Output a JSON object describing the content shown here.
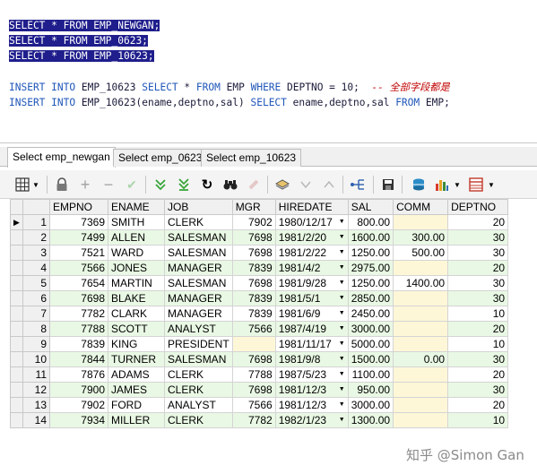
{
  "editor": {
    "selected_lines": [
      "SELECT * FROM EMP_NEWGAN;",
      "SELECT * FROM EMP_0623;",
      "SELECT * FROM EMP_10623;"
    ],
    "insert1": {
      "kw_insert": "INSERT",
      "kw_into": "INTO",
      "table": "EMP_10623",
      "kw_select": "SELECT",
      "star": "*",
      "kw_from": "FROM",
      "src": "EMP",
      "kw_where": "WHERE",
      "cond": "DEPTNO = 10;",
      "comment": "-- 全部字段都是"
    },
    "insert2": {
      "kw_insert": "INSERT",
      "kw_into": "INTO",
      "target": "EMP_10623(ename,deptno,sal)",
      "kw_select": "SELECT",
      "cols": "ename,deptno,sal",
      "kw_from": "FROM",
      "src": "EMP;"
    }
  },
  "tabs": [
    "Select emp_newgan",
    "Select emp_0623",
    "Select emp_10623"
  ],
  "grid": {
    "columns": [
      "EMPNO",
      "ENAME",
      "JOB",
      "MGR",
      "HIREDATE",
      "SAL",
      "COMM",
      "DEPTNO"
    ],
    "rows": [
      [
        "1",
        "7369",
        "SMITH",
        "CLERK",
        "7902",
        "1980/12/17",
        "800.00",
        "",
        "20"
      ],
      [
        "2",
        "7499",
        "ALLEN",
        "SALESMAN",
        "7698",
        "1981/2/20",
        "1600.00",
        "300.00",
        "30"
      ],
      [
        "3",
        "7521",
        "WARD",
        "SALESMAN",
        "7698",
        "1981/2/22",
        "1250.00",
        "500.00",
        "30"
      ],
      [
        "4",
        "7566",
        "JONES",
        "MANAGER",
        "7839",
        "1981/4/2",
        "2975.00",
        "",
        "20"
      ],
      [
        "5",
        "7654",
        "MARTIN",
        "SALESMAN",
        "7698",
        "1981/9/28",
        "1250.00",
        "1400.00",
        "30"
      ],
      [
        "6",
        "7698",
        "BLAKE",
        "MANAGER",
        "7839",
        "1981/5/1",
        "2850.00",
        "",
        "30"
      ],
      [
        "7",
        "7782",
        "CLARK",
        "MANAGER",
        "7839",
        "1981/6/9",
        "2450.00",
        "",
        "10"
      ],
      [
        "8",
        "7788",
        "SCOTT",
        "ANALYST",
        "7566",
        "1987/4/19",
        "3000.00",
        "",
        "20"
      ],
      [
        "9",
        "7839",
        "KING",
        "PRESIDENT",
        "",
        "1981/11/17",
        "5000.00",
        "",
        "10"
      ],
      [
        "10",
        "7844",
        "TURNER",
        "SALESMAN",
        "7698",
        "1981/9/8",
        "1500.00",
        "0.00",
        "30"
      ],
      [
        "11",
        "7876",
        "ADAMS",
        "CLERK",
        "7788",
        "1987/5/23",
        "1100.00",
        "",
        "20"
      ],
      [
        "12",
        "7900",
        "JAMES",
        "CLERK",
        "7698",
        "1981/12/3",
        "950.00",
        "",
        "30"
      ],
      [
        "13",
        "7902",
        "FORD",
        "ANALYST",
        "7566",
        "1981/12/3",
        "3000.00",
        "",
        "20"
      ],
      [
        "14",
        "7934",
        "MILLER",
        "CLERK",
        "7782",
        "1982/1/23",
        "1300.00",
        "",
        "10"
      ]
    ]
  },
  "toolbar_icons": [
    "grid-view-icon",
    "lock-icon",
    "add-record-icon",
    "delete-record-icon",
    "post-changes-icon",
    "fetch-next-icon",
    "fetch-last-icon",
    "refresh-icon",
    "find-icon",
    "clear-icon",
    "query-by-example-icon",
    "sort-desc-icon",
    "sort-asc-icon",
    "link-icon",
    "save-icon",
    "export-icon",
    "chart-icon",
    "single-record-icon"
  ],
  "watermark": "知乎 @Simon Gan",
  "colors": {
    "selection": "#1f1e8c",
    "keyword": "#1f56b8",
    "comment": "#c00000",
    "row_alt": "#e9f8e4"
  }
}
